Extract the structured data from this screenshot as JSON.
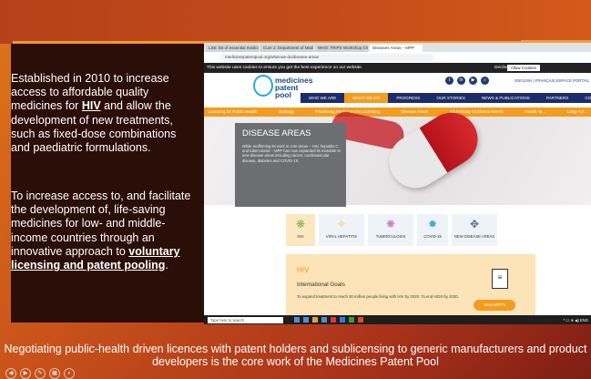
{
  "slide": {
    "para1": {
      "before": "Established in 2010 to increase access to affordable quality medicines for ",
      "link": "HIV",
      "after": " and allow the development of new treatments, such as fixed-dose combinations and paediatric formulations."
    },
    "para2": {
      "before": "To increase access to, and facilitate the development of, life-saving medicines for low- and middle-income countries through an innovative approach to ",
      "link": "voluntary licensing and patent pooling",
      "after": "."
    },
    "caption": "Negotiating public-health driven licences with patent holders and sublicensing to generic manufacturers and product developers is the core work of the Medicines Patent Pool"
  },
  "browser": {
    "tabs": [
      "LSE: list of essential medicines",
      "Cure 2: Department of Medicines",
      "WHO: TRIPS Workshop Chart",
      "Diseases Areas – MPP"
    ],
    "url": "medicinespatentpool.org/what-we-do/disease-areas"
  },
  "cookie": {
    "message": "This website uses cookies to ensure you get the best experience on our website.",
    "decline": "Decline",
    "allow": "Allow Cookies"
  },
  "site": {
    "logo": [
      "medicines",
      "patent",
      "pool"
    ],
    "lang": "ENGLISH | FRANÇAIS     ESPACE PORTAIL",
    "social": [
      "t",
      "in",
      "▶",
      "⌕"
    ],
    "mainnav": [
      "WHO WE ARE",
      "WHAT WE DO",
      "PROGRESS",
      "OUR STORIES",
      "NEWS & PUBLICATIONS",
      "PARTNERS",
      "CONTACT US"
    ],
    "subnav": [
      "Licensing for Public Health",
      "Strategy",
      "Prioritising Medicines for Licensing",
      "Disease Areas",
      "Addressing Children's Needs",
      "Health Te...",
      "Long-Act..."
    ],
    "disease_title": "DISEASE AREAS",
    "disease_text": "While reaffirming its work in core areas – HIV, hepatitis C and tuberculosis – MPP has now expanded its mandate to new disease areas including cancer, cardiovascular disease, diabetes and COVID-19.",
    "cards": [
      {
        "label": "HIV",
        "icon": "❋"
      },
      {
        "label": "VIRAL HEPATITIS",
        "icon": "✧"
      },
      {
        "label": "TUBERCULOSIS",
        "icon": "✺"
      },
      {
        "label": "COVID-19",
        "icon": "✹"
      },
      {
        "label": "NEW DISEASE AREAS",
        "icon": "✥"
      }
    ],
    "hiv_title": "HIV",
    "intl_title": "International Goals",
    "intl_text": "To expand treatment to reach 30 million people living with HIV by 2020. To end AIDS by 2030.",
    "view_btn": "View MPP's"
  },
  "taskbar": {
    "search": "Type here to search",
    "clock": "^ ☐ ⊕ ◀) ENG"
  },
  "colors": {
    "accent": "#f39c1f",
    "navy": "#1d2d6b",
    "slide_dark": "#2a0e08"
  }
}
